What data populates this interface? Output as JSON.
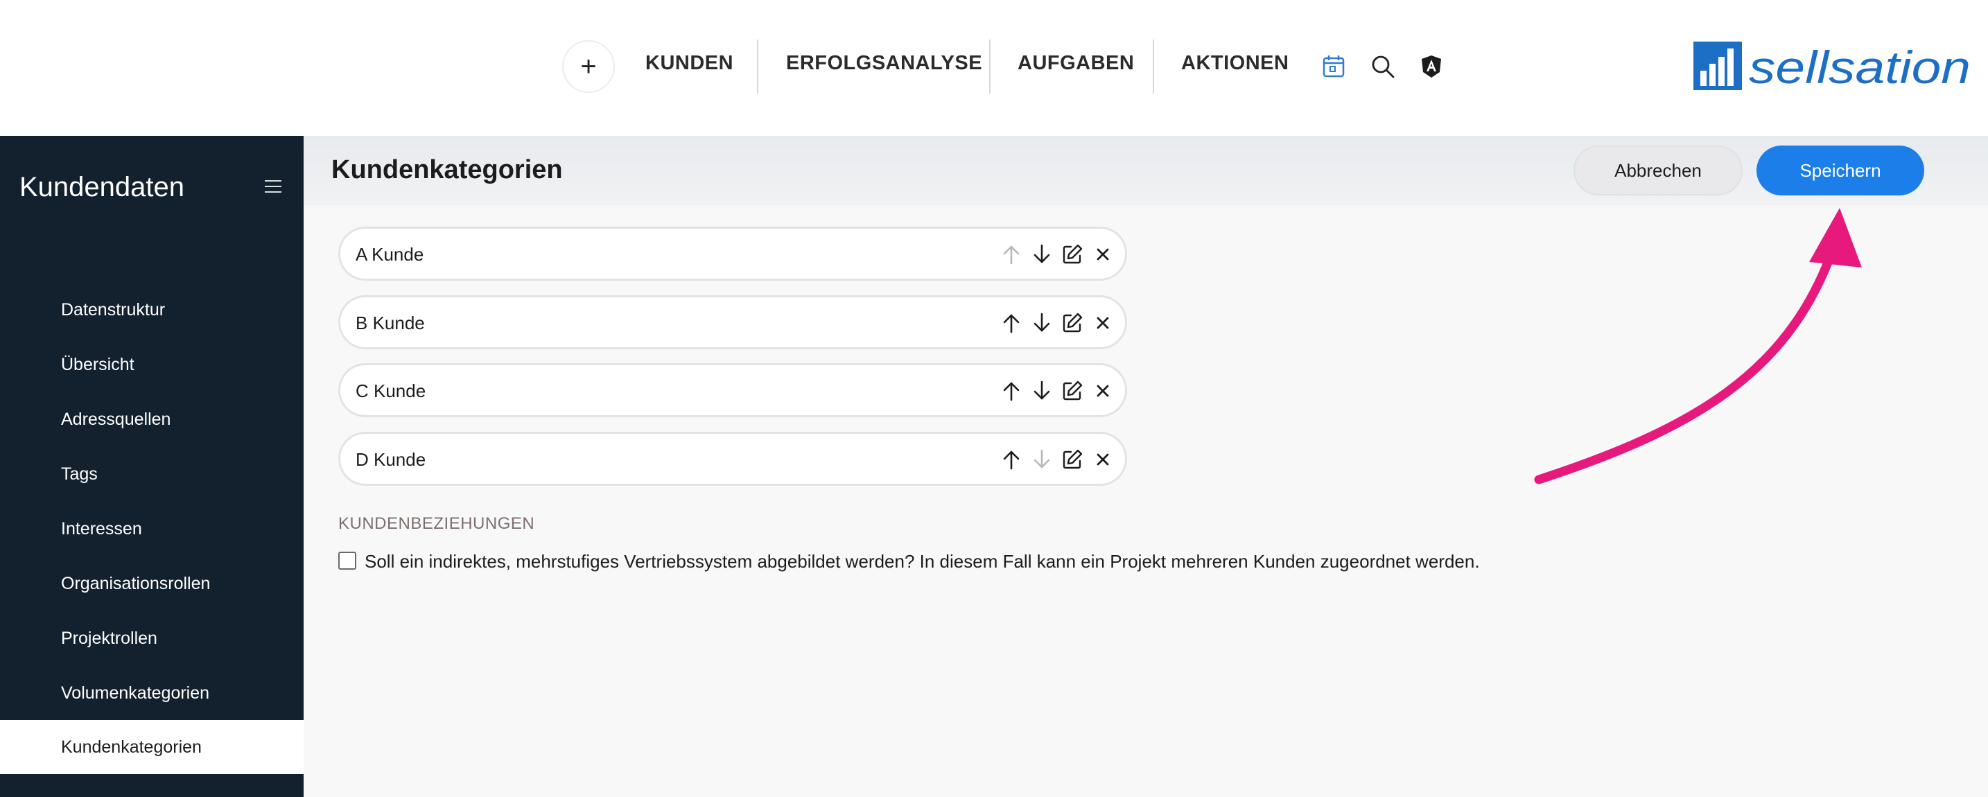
{
  "topnav": {
    "add_label": "+",
    "items": [
      {
        "label": "KUNDEN"
      },
      {
        "label": "ERFOLGSANALYSE"
      },
      {
        "label": "AUFGABEN"
      },
      {
        "label": "AKTIONEN"
      }
    ],
    "icons": [
      "calendar-icon",
      "search-icon",
      "angular-shield-icon"
    ],
    "logo_text": "sellsation"
  },
  "sidebar": {
    "title": "Kundendaten",
    "items": [
      {
        "label": "Datenstruktur"
      },
      {
        "label": "Übersicht"
      },
      {
        "label": "Adressquellen"
      },
      {
        "label": "Tags"
      },
      {
        "label": "Interessen"
      },
      {
        "label": "Organisationsrollen"
      },
      {
        "label": "Projektrollen"
      },
      {
        "label": "Volumenkategorien"
      },
      {
        "label": "Kundenkategorien",
        "active": true
      }
    ]
  },
  "header": {
    "title": "Kundenkategorien",
    "cancel_label": "Abbrechen",
    "save_label": "Speichern"
  },
  "categories": [
    {
      "label": "A Kunde",
      "up_enabled": false,
      "down_enabled": true
    },
    {
      "label": "B Kunde",
      "up_enabled": true,
      "down_enabled": true
    },
    {
      "label": "C Kunde",
      "up_enabled": true,
      "down_enabled": true
    },
    {
      "label": "D Kunde",
      "up_enabled": true,
      "down_enabled": false
    }
  ],
  "relations": {
    "section_label": "KUNDENBEZIEHUNGEN",
    "checkbox_label": "Soll ein indirektes, mehrstufiges Vertriebssystem abgebildet werden? In diesem Fall kann ein Projekt mehreren Kunden zugeordnet werden.",
    "checked": false
  },
  "colors": {
    "accent": "#1b7ee9",
    "sidebar_bg": "#13212f",
    "annotation_arrow": "#e8197d"
  }
}
